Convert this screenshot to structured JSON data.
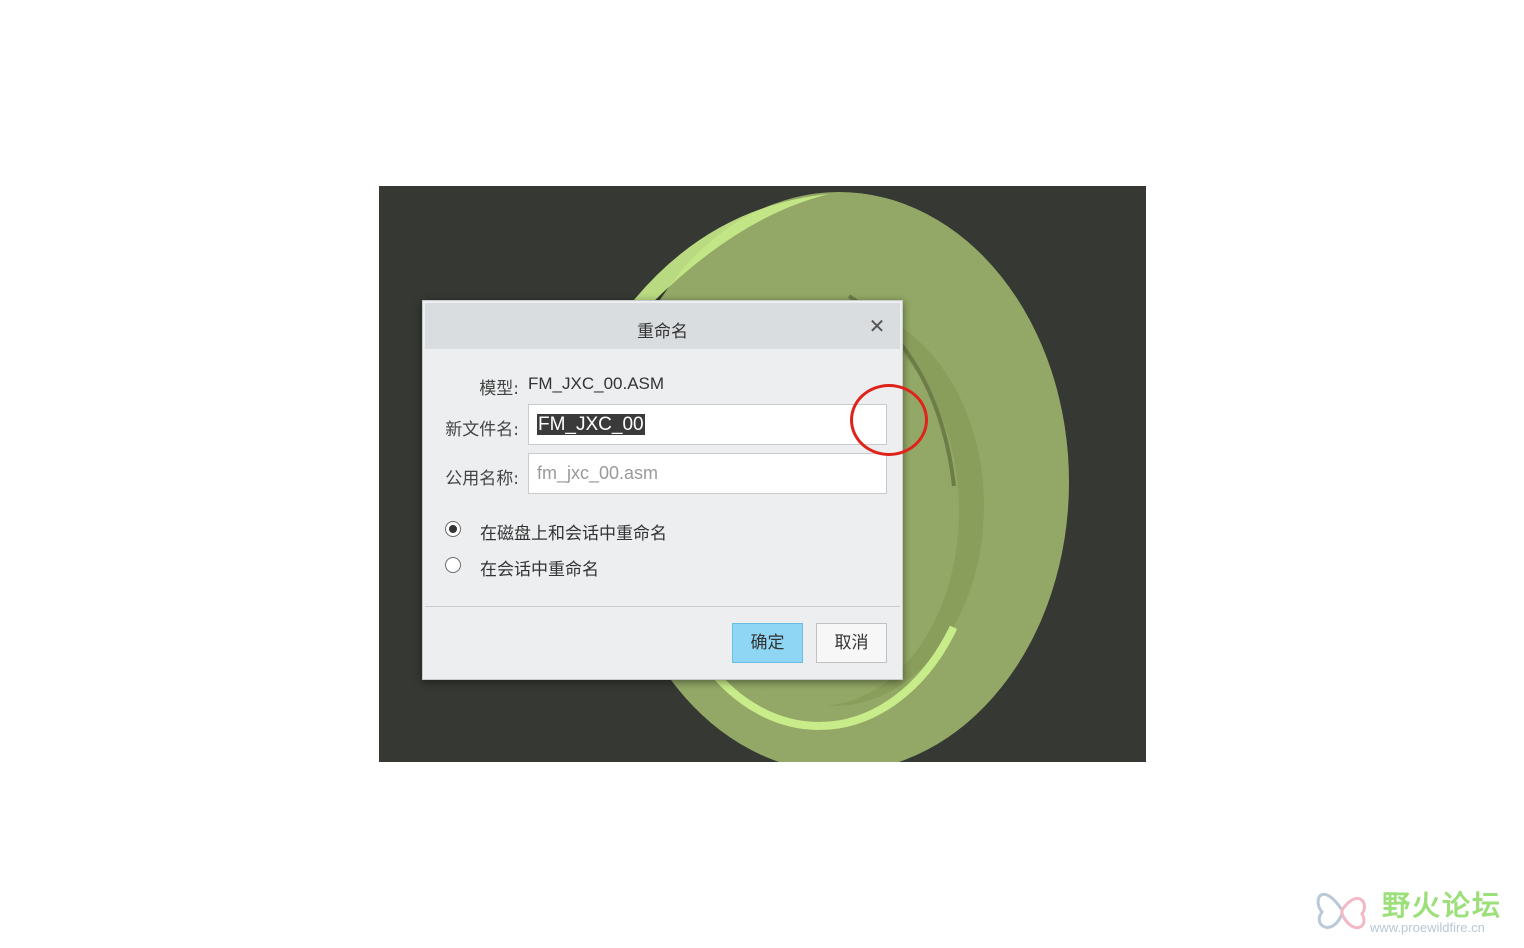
{
  "dialog": {
    "title": "重命名",
    "close_icon": "close-icon",
    "model_label": "模型:",
    "model_value": "FM_JXC_00.ASM",
    "new_filename_label": "新文件名:",
    "new_filename_value": "FM_JXC_00",
    "common_name_label": "公用名称:",
    "common_name_placeholder": "fm_jxc_00.asm",
    "options": [
      {
        "label": "在磁盘上和会话中重命名",
        "checked": true
      },
      {
        "label": "在会话中重命名",
        "checked": false
      }
    ],
    "ok_label": "确定",
    "cancel_label": "取消"
  },
  "colors": {
    "viewport_bg": "#353833",
    "model_green": "#93a866",
    "highlight_green": "#c8ec8a",
    "ok_button": "#8fd6f5",
    "annotation": "#e0231a"
  },
  "watermark": {
    "title": "野火论坛",
    "url": "www.proewildfire.cn"
  }
}
